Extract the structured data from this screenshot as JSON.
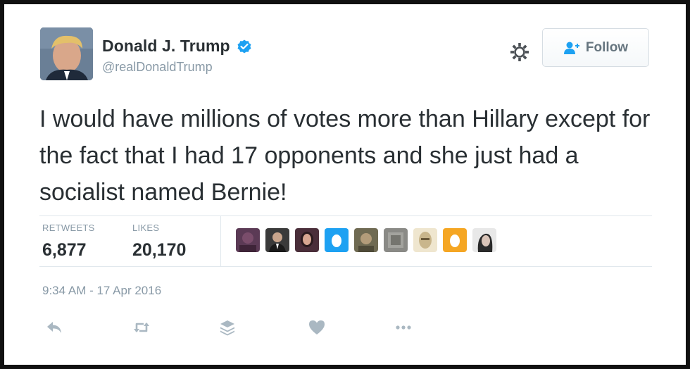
{
  "author": {
    "name": "Donald J. Trump",
    "handle": "@realDonaldTrump",
    "verified": true
  },
  "header": {
    "follow_label": "Follow",
    "settings_icon": "gear-icon"
  },
  "tweet": {
    "text": "I would have millions of votes more than Hillary except for the fact that I had 17 opponents and she just had a socialist named Bernie!",
    "timestamp": "9:34 AM - 17 Apr 2016"
  },
  "stats": {
    "retweets_label": "RETWEETS",
    "retweets_value": "6,877",
    "likes_label": "LIKES",
    "likes_value": "20,170"
  },
  "likers": [
    {
      "icon": "liker-avatar-1",
      "color": "#5b3a55"
    },
    {
      "icon": "liker-avatar-2",
      "color": "#3a3a3a"
    },
    {
      "icon": "liker-avatar-3",
      "color": "#4a2e3a"
    },
    {
      "icon": "default-egg-avatar",
      "color": "#1da1f2"
    },
    {
      "icon": "liker-avatar-5",
      "color": "#6f6a52"
    },
    {
      "icon": "liker-avatar-6",
      "color": "#8a8a86"
    },
    {
      "icon": "liker-avatar-7",
      "color": "#c9b68c"
    },
    {
      "icon": "default-egg-avatar",
      "color": "#f5a623"
    },
    {
      "icon": "liker-avatar-9",
      "color": "#bdbdbd"
    }
  ],
  "actions": [
    "reply-icon",
    "retweet-icon",
    "buffer-icon",
    "like-icon",
    "more-icon"
  ],
  "colors": {
    "text": "#292f33",
    "secondary": "#8899a6",
    "verified": "#1da1f2",
    "action_icon": "#aab8c2"
  }
}
